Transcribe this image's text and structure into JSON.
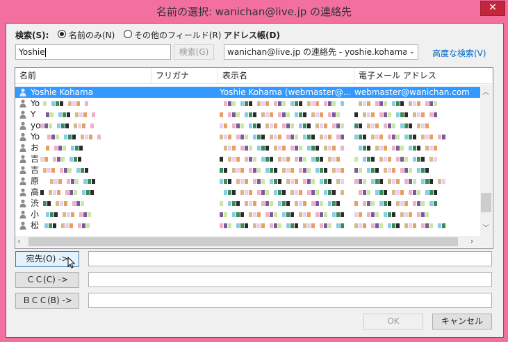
{
  "window": {
    "title": "名前の選択: wanichan@live.jp の連絡先",
    "close_glyph": "✕"
  },
  "search": {
    "label": "検索(S):",
    "option_name_only": "名前のみ(N)",
    "option_other_fields": "その他のフィールド(R)",
    "selected": "name_only",
    "value": "Yoshie",
    "button": "検索(G)"
  },
  "address_book": {
    "label": "アドレス帳(D)",
    "value": "wanichan@live.jp の連絡先 - yoshie.kohama@",
    "advanced_search": "高度な検索(V)"
  },
  "list": {
    "columns": [
      "名前",
      "フリガナ",
      "表示名",
      "電子メール アドレス"
    ],
    "sort_glyph": "^",
    "rows": [
      {
        "name": "Yoshie Kohama",
        "furigana": "",
        "display": "Yoshie Kohama (webmaster@...",
        "email": "webmaster@wanichan.com",
        "selected": true
      },
      {
        "name": "Yo",
        "selected": false
      },
      {
        "name": "Y",
        "selected": false
      },
      {
        "name": "yo",
        "selected": false
      },
      {
        "name": "Yo",
        "selected": false
      },
      {
        "name": "お",
        "selected": false
      },
      {
        "name": "吉",
        "selected": false
      },
      {
        "name": "吉",
        "selected": false
      },
      {
        "name": "原",
        "selected": false
      },
      {
        "name": "高",
        "selected": false
      },
      {
        "name": "渋",
        "selected": false
      },
      {
        "name": "小",
        "selected": false
      },
      {
        "name": "松",
        "selected": false
      }
    ]
  },
  "recipients": {
    "to_button": "宛先(O) ->",
    "cc_button": "ＣＣ(C) ->",
    "bcc_button": "ＢＣＣ(B) ->",
    "to_value": "",
    "cc_value": "",
    "bcc_value": ""
  },
  "footer": {
    "ok": "OK",
    "cancel": "キャンセル"
  },
  "colors": {
    "selection": "#3399ff",
    "title_bar": "#f26f9e",
    "close": "#c2263d"
  },
  "icons": [
    "person-icon",
    "close-icon",
    "sort-arrow-icon",
    "chevron-down-icon",
    "scroll-up-icon",
    "scroll-down-icon",
    "scroll-left-icon",
    "scroll-right-icon",
    "mouse-cursor-icon"
  ]
}
